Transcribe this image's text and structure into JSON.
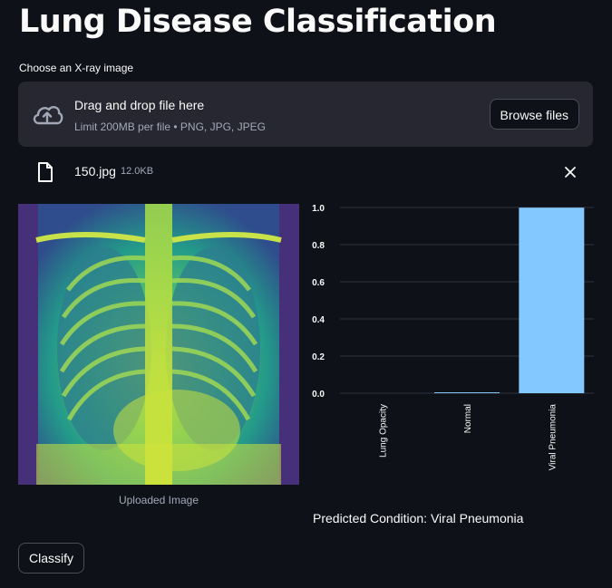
{
  "app": {
    "title": "Lung Disease Classification"
  },
  "uploader": {
    "label": "Choose an X-ray image",
    "drop_text": "Drag and drop file here",
    "limit_text": "Limit 200MB per file • PNG, JPG, JPEG",
    "browse_label": "Browse files",
    "icon": "cloud-upload-icon"
  },
  "uploaded_file": {
    "name": "150.jpg",
    "size": "12.0KB",
    "icon": "file-icon",
    "remove_icon": "close-icon"
  },
  "image": {
    "caption": "Uploaded Image"
  },
  "chart_data": {
    "type": "bar",
    "categories": [
      "Lung Opacity",
      "Normal",
      "Viral Pneumonia"
    ],
    "values": [
      0.0,
      0.004,
      0.999
    ],
    "yticks": [
      "0.0",
      "0.2",
      "0.4",
      "0.6",
      "0.8",
      "1.0"
    ],
    "ylim": [
      0,
      1.0
    ],
    "bar_color": "#83c9ff",
    "grid": true,
    "title": "",
    "xlabel": "",
    "ylabel": ""
  },
  "result": {
    "prediction": "Predicted Condition: Viral Pneumonia"
  },
  "actions": {
    "classify_label": "Classify"
  },
  "colors": {
    "background": "#0e1117",
    "surface": "#262730",
    "text": "#fafafa",
    "muted": "#a3a8b8",
    "bar": "#83c9ff"
  }
}
